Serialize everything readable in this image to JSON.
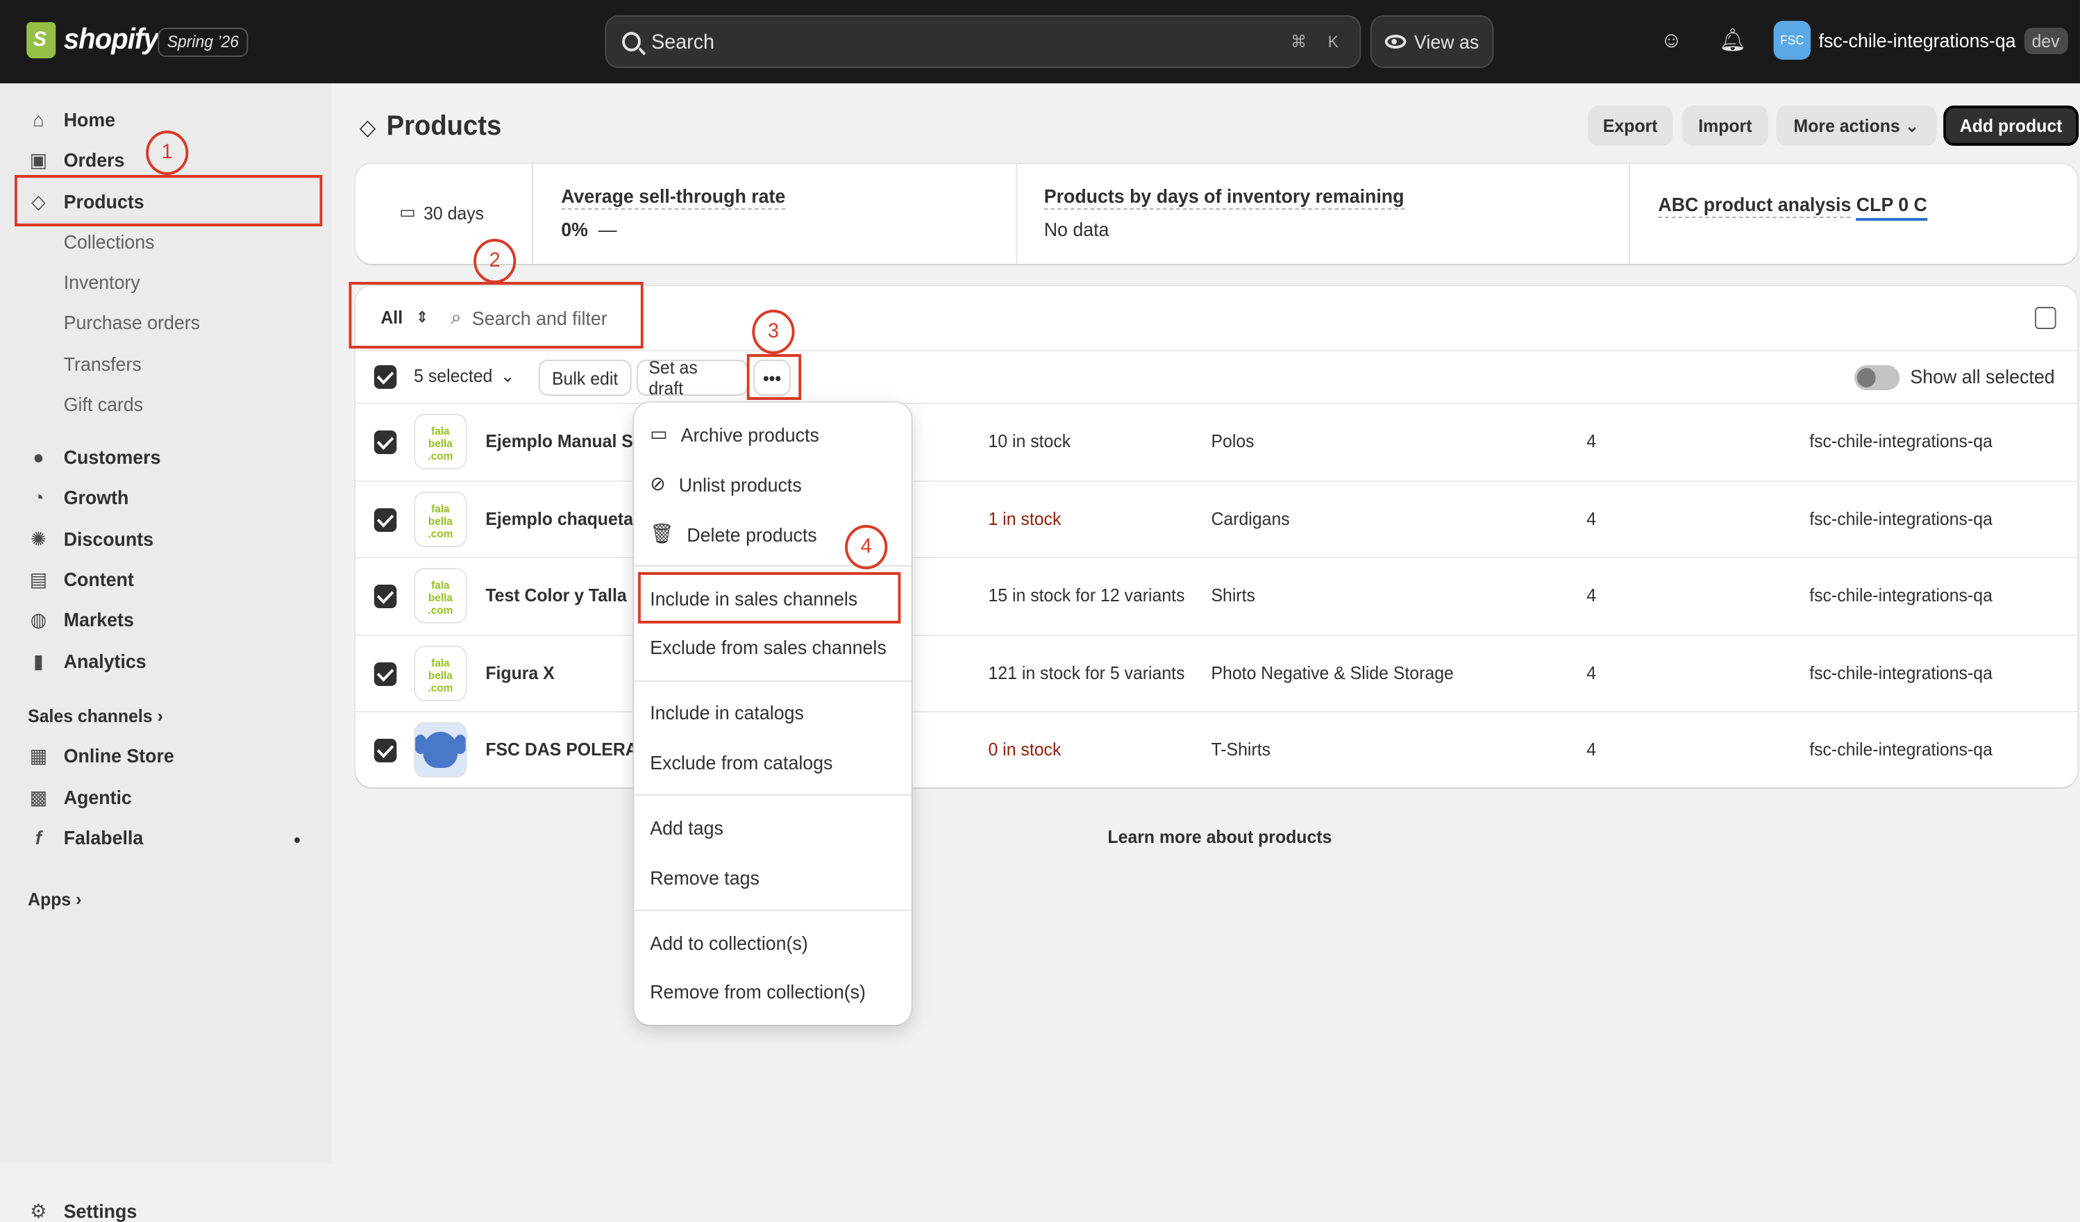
{
  "topbar": {
    "brand": "shopify",
    "edition": "Spring ’26",
    "search_placeholder": "Search",
    "shortcut_keys": [
      "⌘",
      "K"
    ],
    "view_as": "View as",
    "store_initials": "FSC",
    "store_name": "fsc-chile-integrations-qa",
    "store_badge": "dev"
  },
  "sidebar": {
    "primary": [
      {
        "label": "Home",
        "icon": "home-icon"
      },
      {
        "label": "Orders",
        "icon": "inbox-icon"
      },
      {
        "label": "Products",
        "icon": "tag-icon"
      }
    ],
    "product_sub": [
      "Collections",
      "Inventory",
      "Purchase orders",
      "Transfers",
      "Gift cards"
    ],
    "secondary": [
      {
        "label": "Customers",
        "icon": "person-icon"
      },
      {
        "label": "Growth",
        "icon": "gauge-icon"
      },
      {
        "label": "Discounts",
        "icon": "discount-icon"
      },
      {
        "label": "Content",
        "icon": "content-icon"
      },
      {
        "label": "Markets",
        "icon": "globe-icon"
      },
      {
        "label": "Analytics",
        "icon": "bar-chart-icon"
      }
    ],
    "sales_channels_heading": "Sales channels",
    "channels": [
      {
        "label": "Online Store",
        "icon": "store-icon"
      },
      {
        "label": "Agentic",
        "icon": "robot-icon"
      },
      {
        "label": "Falabella",
        "icon": "falabella-icon"
      }
    ],
    "apps_heading": "Apps",
    "settings": "Settings"
  },
  "page": {
    "title": "Products",
    "actions": {
      "export": "Export",
      "import": "Import",
      "more": "More actions",
      "add": "Add product"
    }
  },
  "metrics": {
    "period": "30 days",
    "items": [
      {
        "title": "Average sell-through rate",
        "value": "0%",
        "extra": "—"
      },
      {
        "title": "Products by days of inventory remaining",
        "value": "No data"
      },
      {
        "title": "ABC product analysis",
        "value": "CLP 0 C"
      }
    ]
  },
  "filter": {
    "tab": "All",
    "search_placeholder": "Search and filter"
  },
  "bulk": {
    "selected": "5 selected",
    "bulk_edit": "Bulk edit",
    "set_draft": "Set as draft",
    "more": "•••",
    "show_all": "Show all selected"
  },
  "products": [
    {
      "name": "Ejemplo Manual Sh",
      "inventory": "10 in stock",
      "inv_alert": false,
      "type": "Polos",
      "markets": "4",
      "vendor": "fsc-chile-integrations-qa",
      "thumb": "falabella"
    },
    {
      "name": "Ejemplo chaqueta",
      "inventory": "1 in stock",
      "inv_alert": true,
      "type": "Cardigans",
      "markets": "4",
      "vendor": "fsc-chile-integrations-qa",
      "thumb": "falabella"
    },
    {
      "name": "Test Color y Talla",
      "inventory": "15 in stock for 12 variants",
      "inv_alert": false,
      "type": "Shirts",
      "markets": "4",
      "vendor": "fsc-chile-integrations-qa",
      "thumb": "falabella"
    },
    {
      "name": "Figura X",
      "inventory": "121 in stock for 5 variants",
      "inv_alert": false,
      "type": "Photo Negative & Slide Storage",
      "markets": "4",
      "vendor": "fsc-chile-integrations-qa",
      "thumb": "falabella"
    },
    {
      "name": "FSC DAS POLERA",
      "inventory": "0 in stock",
      "inv_alert": true,
      "type": "T-Shirts",
      "markets": "4",
      "vendor": "fsc-chile-integrations-qa",
      "thumb": "stitch"
    }
  ],
  "thumb_text": {
    "l1": "fala",
    "l2": "bella",
    "l3": ".com"
  },
  "menu": {
    "archive": "Archive products",
    "unlist": "Unlist products",
    "delete": "Delete products",
    "include_channels": "Include in sales channels",
    "exclude_channels": "Exclude from sales channels",
    "include_catalogs": "Include in catalogs",
    "exclude_catalogs": "Exclude from catalogs",
    "add_tags": "Add tags",
    "remove_tags": "Remove tags",
    "add_collection": "Add to collection(s)",
    "remove_collection": "Remove from collection(s)"
  },
  "footer_link": "Learn more about products",
  "annotations": [
    "1",
    "2",
    "3",
    "4"
  ],
  "colors": {
    "annotation": "#d93a26",
    "critical": "#8e1f0b",
    "topbar": "#1a1a1a",
    "brand_green": "#95bf47"
  }
}
